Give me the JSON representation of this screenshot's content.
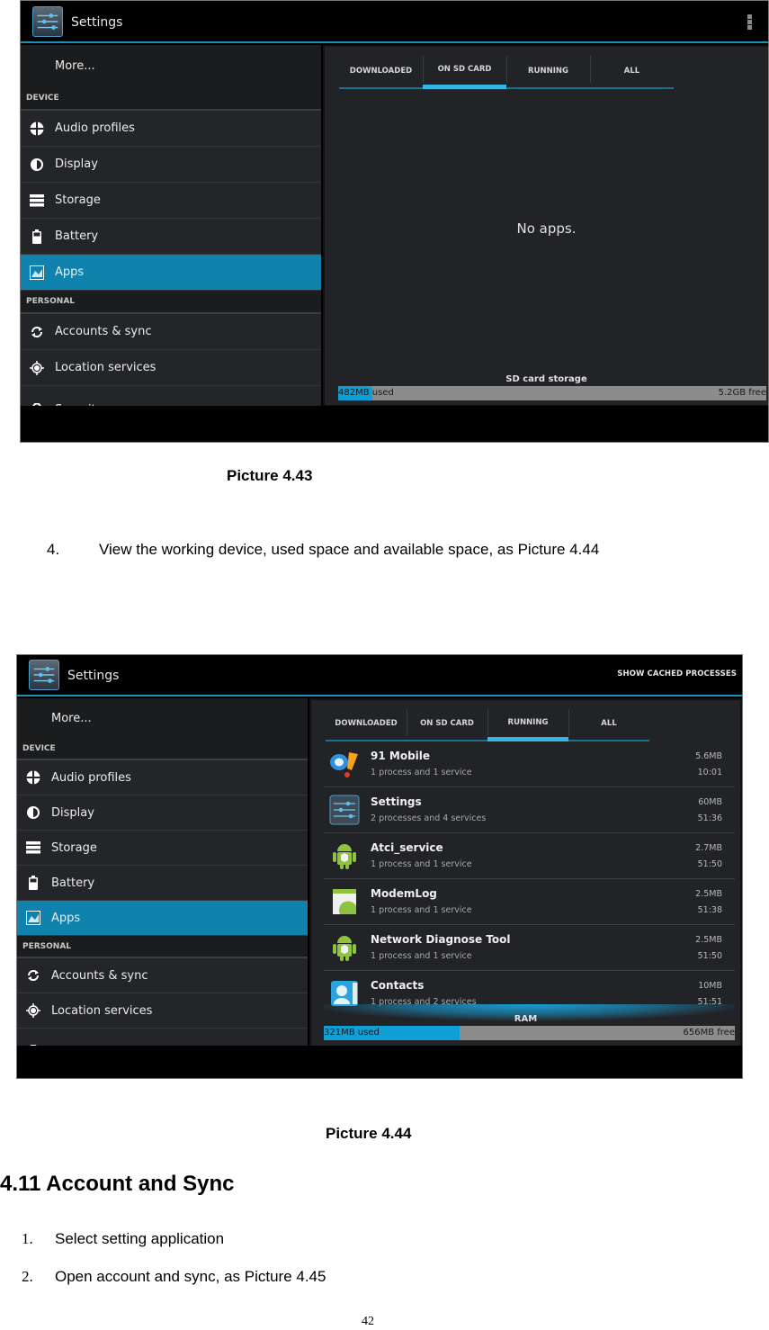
{
  "picture_1": {
    "app_title": "Settings",
    "sidebar": {
      "more_label": "More...",
      "device_header": "DEVICE",
      "device_items": [
        {
          "label": "Audio profiles",
          "icon": "audio-profiles-icon"
        },
        {
          "label": "Display",
          "icon": "display-icon"
        },
        {
          "label": "Storage",
          "icon": "storage-icon"
        },
        {
          "label": "Battery",
          "icon": "battery-icon"
        },
        {
          "label": "Apps",
          "icon": "apps-icon",
          "active": true
        }
      ],
      "personal_header": "PERSONAL",
      "personal_items": [
        {
          "label": "Accounts & sync",
          "icon": "sync-icon"
        },
        {
          "label": "Location services",
          "icon": "location-icon"
        },
        {
          "label": "Security",
          "icon": "lock-icon"
        }
      ]
    },
    "tabs": [
      "DOWNLOADED",
      "ON SD CARD",
      "RUNNING",
      "ALL"
    ],
    "active_tab": "ON SD CARD",
    "empty_message": "No apps.",
    "storage": {
      "label": "SD card storage",
      "used": "482MB",
      "used_suffix": " used",
      "free": "5.2GB free",
      "used_fraction": 0.08
    },
    "caption": "Picture 4.43"
  },
  "step_4": {
    "number": "4.",
    "text": "View the working device, used space and available space, as Picture 4.44"
  },
  "picture_2": {
    "app_title": "Settings",
    "action": "SHOW CACHED PROCESSES",
    "sidebar": {
      "more_label": "More...",
      "device_header": "DEVICE",
      "device_items": [
        {
          "label": "Audio profiles"
        },
        {
          "label": "Display"
        },
        {
          "label": "Storage"
        },
        {
          "label": "Battery"
        },
        {
          "label": "Apps",
          "active": true
        }
      ],
      "personal_header": "PERSONAL",
      "personal_items": [
        {
          "label": "Accounts & sync"
        },
        {
          "label": "Location services"
        },
        {
          "label": "Security"
        }
      ]
    },
    "tabs": [
      "DOWNLOADED",
      "ON SD CARD",
      "RUNNING",
      "ALL"
    ],
    "active_tab": "RUNNING",
    "processes": [
      {
        "name": "91 Mobile",
        "desc": "1 process and 1 service",
        "size": "5.6MB",
        "time": "10:01",
        "icon": "91-mobile-icon"
      },
      {
        "name": "Settings",
        "desc": "2 processes and 4 services",
        "size": "60MB",
        "time": "51:36",
        "icon": "settings-icon"
      },
      {
        "name": "Atci_service",
        "desc": "1 process and 1 service",
        "size": "2.7MB",
        "time": "51:50",
        "icon": "android-icon"
      },
      {
        "name": "ModemLog",
        "desc": "1 process and 1 service",
        "size": "2.5MB",
        "time": "51:38",
        "icon": "modemlog-icon"
      },
      {
        "name": "Network Diagnose Tool",
        "desc": "1 process and 1 service",
        "size": "2.5MB",
        "time": "51:50",
        "icon": "android-icon"
      },
      {
        "name": "Contacts",
        "desc": "1 process and 2 services",
        "size": "10MB",
        "time": "51:51",
        "icon": "contacts-icon"
      }
    ],
    "ram": {
      "label": "RAM",
      "used": "321MB used",
      "free": "656MB free",
      "used_fraction": 0.33
    },
    "caption": "Picture 4.44"
  },
  "section": {
    "heading": "4.11 Account and Sync",
    "steps": [
      {
        "number": "1.",
        "text": "Select setting application"
      },
      {
        "number": "2.",
        "text": "Open account and sync, as Picture 4.45"
      }
    ]
  },
  "page_number": "42",
  "colors": {
    "accent": "#33b5e5",
    "selected_item": "#0f82ad",
    "storage_used": "#0e9fd6",
    "storage_free": "#8c8c8c"
  }
}
